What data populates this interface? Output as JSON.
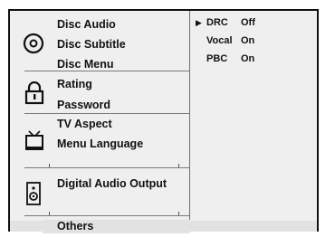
{
  "menu": {
    "groups": [
      {
        "icon": "disc-icon",
        "items": [
          "Disc Audio",
          "Disc Subtitle",
          "Disc Menu"
        ]
      },
      {
        "icon": "lock-icon",
        "items": [
          "Rating",
          "Password"
        ]
      },
      {
        "icon": "tv-icon",
        "items": [
          "TV Aspect",
          "Menu Language"
        ]
      },
      {
        "icon": "speaker-icon",
        "items": [
          "Digital Audio Output"
        ]
      }
    ],
    "selected_bottom": "Others"
  },
  "settings": [
    {
      "label": "DRC",
      "value": "Off",
      "selected": true
    },
    {
      "label": "Vocal",
      "value": "On",
      "selected": false
    },
    {
      "label": "PBC",
      "value": "On",
      "selected": false
    }
  ],
  "selection_marker": "▶"
}
